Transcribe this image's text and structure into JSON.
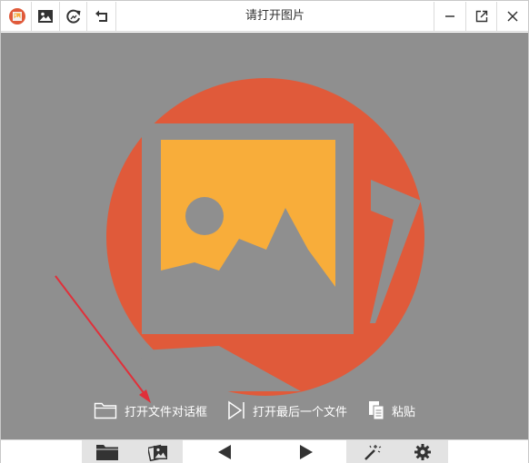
{
  "window": {
    "title": "请打开图片",
    "brand_color": "#e05a3a",
    "accent_color": "#f8ad3a",
    "canvas_color": "#8f8f8f"
  },
  "titlebar": {
    "left_icons": [
      "app-logo-icon",
      "image-icon",
      "rotate-icon",
      "undo-icon"
    ],
    "right_icons": [
      "minimize-icon",
      "maximize-icon",
      "close-icon"
    ]
  },
  "actions": {
    "open_dialog": "打开文件对话框",
    "open_last": "打开最后一个文件",
    "paste": "粘贴"
  },
  "bottombar": {
    "icons": [
      "folder-icon",
      "gallery-icon",
      "prev-icon",
      "next-icon",
      "magic-wand-icon",
      "gear-icon"
    ],
    "active": [
      "folder-icon",
      "gallery-icon",
      "magic-wand-icon",
      "gear-icon"
    ]
  }
}
